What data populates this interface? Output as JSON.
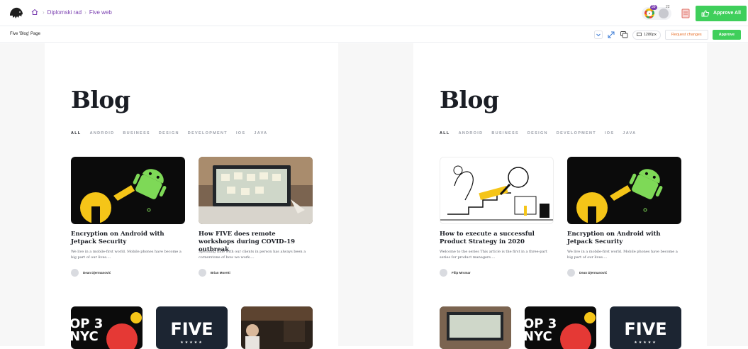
{
  "topbar": {
    "breadcrumb": [
      "Diplomski rad",
      "Five web"
    ],
    "badge_count_1": "39",
    "badge_count_2": "22",
    "approve_all_label": "Approve All"
  },
  "subbar": {
    "page_label": "Five 'Blog' Page",
    "viewport": "1280px",
    "request_changes_label": "Request changes",
    "approve_label": "Approve"
  },
  "left": {
    "title": "Blog",
    "filters": [
      "ALL",
      "ANDROID",
      "BUSINESS",
      "DESIGN",
      "DEVELOPMENT",
      "IOS",
      "JAVA"
    ],
    "cards": [
      {
        "title": "Encryption on Android with Jetpack Security",
        "excerpt": "We live in a mobile-first world. Mobile phones have become a big part of our lives....",
        "author": "Dean Djermanović"
      },
      {
        "title": "How FIVE does remote workshops during COVID-19 outbreak",
        "excerpt": "Spending time with our clients in person has always been a cornerstone of how we work....",
        "author": "Brian Moretti"
      }
    ],
    "thumbs": [
      "OP 3 NYC",
      "FIVE"
    ]
  },
  "right": {
    "title": "Blog",
    "filters": [
      "ALL",
      "ANDROID",
      "BUSINESS",
      "DESIGN",
      "DEVELOPMENT",
      "IOS",
      "JAVA"
    ],
    "cards": [
      {
        "title": "How to execute a successful Product Strategy in 2020",
        "excerpt": "Welcome to the series This article is the first in a three-part series for product managers....",
        "author": "Filip Mrsmar"
      },
      {
        "title": "Encryption on Android with Jetpack Security",
        "excerpt": "We live in a mobile-first world. Mobile phones have become a big part of our lives....",
        "author": "Dean Djermanović"
      }
    ],
    "thumbs": [
      "OP 3 NYC",
      "FIVE"
    ]
  }
}
